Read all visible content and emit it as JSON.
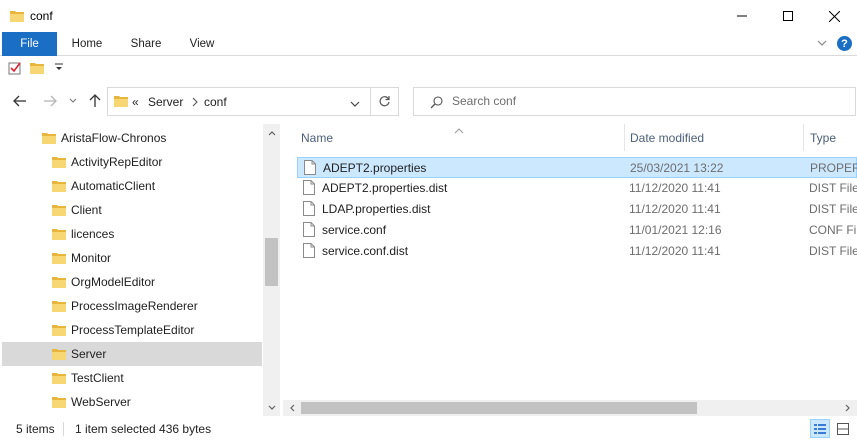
{
  "window": {
    "title": "conf"
  },
  "ribbon": {
    "tabs": [
      {
        "label": "File"
      },
      {
        "label": "Home"
      },
      {
        "label": "Share"
      },
      {
        "label": "View"
      }
    ],
    "help_label": "?"
  },
  "address": {
    "overflow": "«",
    "segments": [
      "Server",
      "conf"
    ]
  },
  "search": {
    "placeholder": "Search conf"
  },
  "nav_tree": [
    {
      "label": "AristaFlow-Chronos",
      "selected": false
    },
    {
      "label": "ActivityRepEditor",
      "selected": false
    },
    {
      "label": "AutomaticClient",
      "selected": false
    },
    {
      "label": "Client",
      "selected": false
    },
    {
      "label": "licences",
      "selected": false
    },
    {
      "label": "Monitor",
      "selected": false
    },
    {
      "label": "OrgModelEditor",
      "selected": false
    },
    {
      "label": "ProcessImageRenderer",
      "selected": false
    },
    {
      "label": "ProcessTemplateEditor",
      "selected": false
    },
    {
      "label": "Server",
      "selected": true
    },
    {
      "label": "TestClient",
      "selected": false
    },
    {
      "label": "WebServer",
      "selected": false
    }
  ],
  "columns": {
    "name": "Name",
    "date": "Date modified",
    "type": "Type"
  },
  "files": [
    {
      "name": "ADEPT2.properties",
      "date": "25/03/2021 13:22",
      "type": "PROPERTI",
      "selected": true
    },
    {
      "name": "ADEPT2.properties.dist",
      "date": "11/12/2020 11:41",
      "type": "DIST File",
      "selected": false
    },
    {
      "name": "LDAP.properties.dist",
      "date": "11/12/2020 11:41",
      "type": "DIST File",
      "selected": false
    },
    {
      "name": "service.conf",
      "date": "11/01/2021 12:16",
      "type": "CONF Fil",
      "selected": false
    },
    {
      "name": "service.conf.dist",
      "date": "11/12/2020 11:41",
      "type": "DIST File",
      "selected": false
    }
  ],
  "status": {
    "count": "5 items",
    "selection": "1 item selected  436 bytes"
  },
  "colors": {
    "accent": "#1a6fc4",
    "selection": "#cce8ff",
    "selection_border": "#99d1ff",
    "folder": "#e8b53e"
  }
}
